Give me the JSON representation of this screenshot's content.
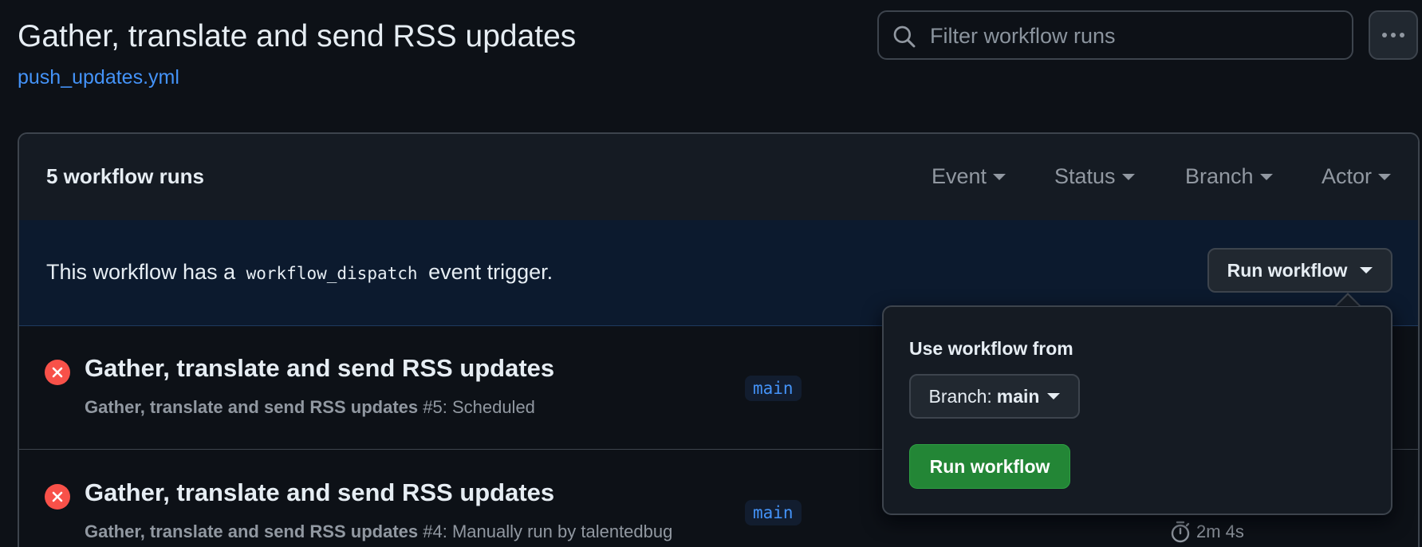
{
  "header": {
    "title": "Gather, translate and send RSS updates",
    "file": "push_updates.yml",
    "search_placeholder": "Filter workflow runs",
    "more_icon": "kebab-horizontal-icon"
  },
  "runs_panel": {
    "count_label": "5 workflow runs",
    "filters": [
      "Event",
      "Status",
      "Branch",
      "Actor"
    ],
    "dispatch": {
      "prefix": "This workflow has a",
      "code": "workflow_dispatch",
      "suffix": "event trigger.",
      "button_label": "Run workflow"
    },
    "runs": [
      {
        "title": "Gather, translate and send RSS updates",
        "workflow": "Gather, translate and send RSS updates",
        "detail": "#5: Scheduled",
        "branch": "main",
        "status_icon": "x-circle-icon",
        "duration": ""
      },
      {
        "title": "Gather, translate and send RSS updates",
        "workflow": "Gather, translate and send RSS updates",
        "detail": "#4: Manually run by talentedbug",
        "branch": "main",
        "status_icon": "x-circle-icon",
        "duration": "2m 4s"
      }
    ]
  },
  "run_dropdown": {
    "label": "Use workflow from",
    "branch_prefix": "Branch:",
    "branch_value": "main",
    "submit_label": "Run workflow"
  },
  "colors": {
    "background": "#0d1117",
    "link": "#4493f8",
    "failure": "#f85149",
    "primary_button": "#238636"
  }
}
